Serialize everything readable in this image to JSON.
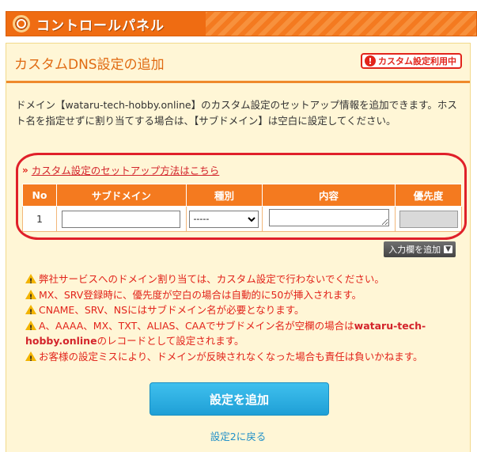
{
  "header": {
    "title": "コントロールパネル"
  },
  "panel": {
    "title": "カスタムDNS設定の追加",
    "badge": "カスタム設定利用中",
    "description": "ドメイン【wataru-tech-hobby.online】のカスタム設定のセットアップ情報を追加できます。ホスト名を指定せずに割り当てする場合は、【サブドメイン】は空白に設定してください。",
    "help_link": "カスタム設定のセットアップ方法はこちら"
  },
  "table": {
    "columns": [
      "No",
      "サブドメイン",
      "種別",
      "内容",
      "優先度"
    ],
    "rows": [
      {
        "no": "1",
        "subdomain": "",
        "type": "-----",
        "content": "",
        "priority": ""
      }
    ]
  },
  "add_row_button": "入力欄を追加",
  "notes": [
    "弊社サービスへのドメイン割り当ては、カスタム設定で行わないでください。",
    "MX、SRV登録時に、優先度が空白の場合は自動的に50が挿入されます。",
    "CNAME、SRV、NSにはサブドメイン名が必要となります。",
    "A、AAAA、MX、TXT、ALIAS、CAAでサブドメイン名が空欄の場合は",
    "wataru-tech-hobby.online",
    "のレコードとして設定されます。",
    "お客様の設定ミスにより、ドメインが反映されなくなった場合も責任は負いかねます。"
  ],
  "submit_button": "設定を追加",
  "back_link": "設定2に戻る",
  "colors": {
    "accent": "#f47a1f",
    "panel_bg": "#fff6d6",
    "alert_red": "#e2241b",
    "submit_blue": "#29abe2"
  }
}
